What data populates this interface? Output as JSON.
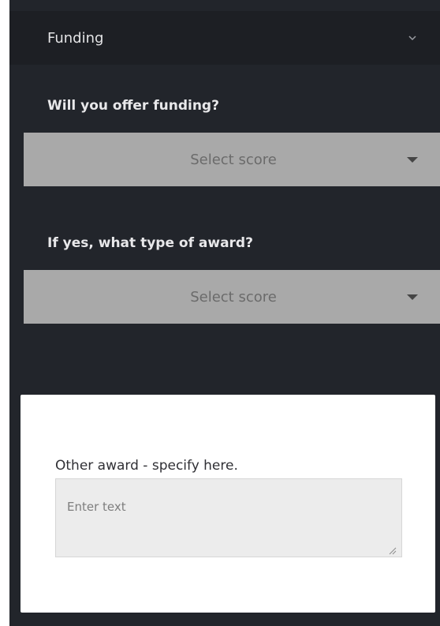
{
  "section": {
    "title": "Funding",
    "chevron_icon": "chevron-down-icon"
  },
  "funding_question": {
    "label": "Will you offer funding?",
    "select_value": "Select score"
  },
  "award_question": {
    "label": "If yes, what type of award?",
    "select_value": "Select score"
  },
  "other_award": {
    "label": "Other award - specify here.",
    "placeholder": "Enter text"
  },
  "colors": {
    "panel_bg": "#22252b",
    "header_bg": "#1d1f24",
    "select_bg": "#a9a9a9",
    "card_bg": "#ffffff"
  }
}
